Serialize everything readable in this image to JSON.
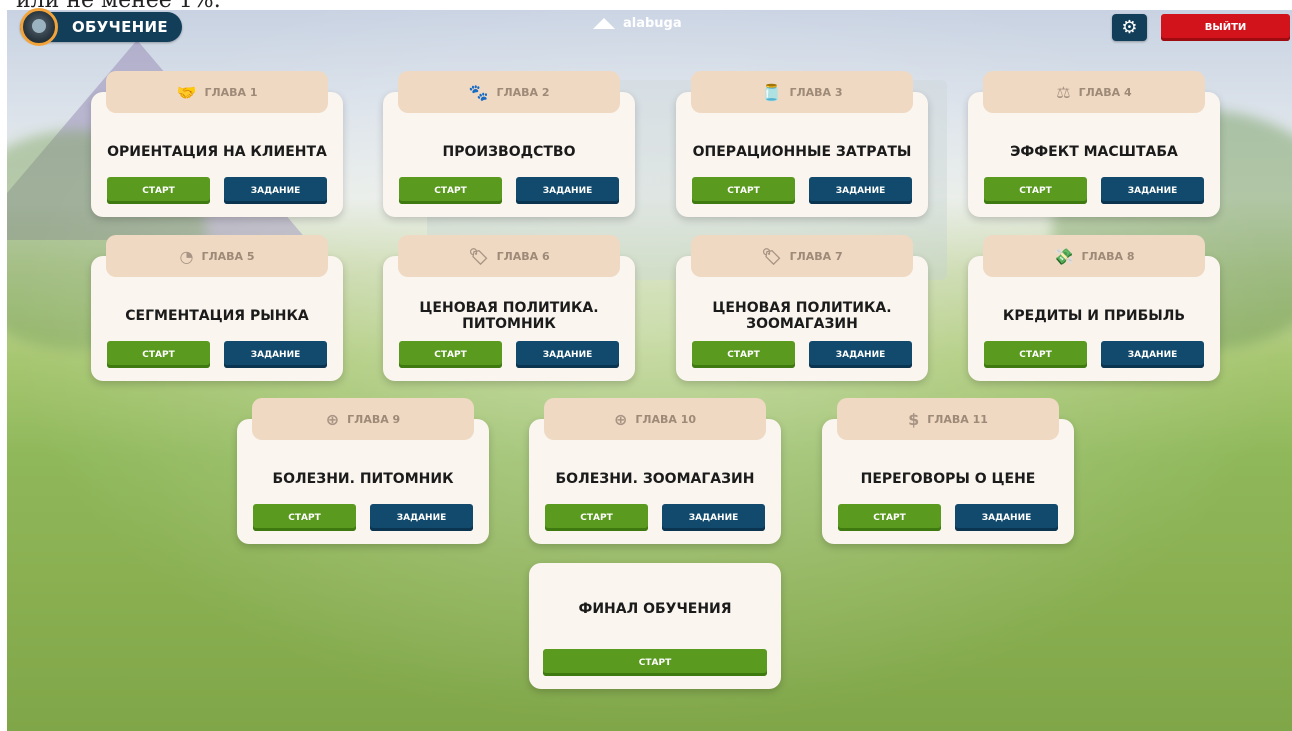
{
  "page_caption": "или не менее 1%.",
  "header": {
    "title": "ОБУЧЕНИЕ",
    "logo_text": "alabuga",
    "settings_icon": "gear-icon",
    "exit_label": "ВЫЙТИ"
  },
  "buttons": {
    "start": "СТАРТ",
    "task": "ЗАДАНИЕ"
  },
  "chapters": [
    {
      "label": "ГЛАВА 1",
      "icon": "handshake-icon",
      "glyph": "🤝",
      "title": "ОРИЕНТАЦИЯ НА КЛИЕНТА"
    },
    {
      "label": "ГЛАВА 2",
      "icon": "pet-icon",
      "glyph": "🐾",
      "title": "ПРОИЗВОДСТВО"
    },
    {
      "label": "ГЛАВА 3",
      "icon": "jar-icon",
      "glyph": "🫙",
      "title": "ОПЕРАЦИОННЫЕ ЗАТРАТЫ"
    },
    {
      "label": "ГЛАВА 4",
      "icon": "scale-icon",
      "glyph": "⚖",
      "title": "ЭФФЕКТ МАСШТАБА"
    },
    {
      "label": "ГЛАВА 5",
      "icon": "pie-chart-icon",
      "glyph": "◔",
      "title": "СЕГМЕНТАЦИЯ РЫНКА"
    },
    {
      "label": "ГЛАВА 6",
      "icon": "price-tag-icon",
      "glyph": "🏷",
      "title": "ЦЕНОВАЯ ПОЛИТИКА. ПИТОМНИК"
    },
    {
      "label": "ГЛАВА 7",
      "icon": "price-tag-icon",
      "glyph": "🏷",
      "title": "ЦЕНОВАЯ ПОЛИТИКА. ЗООМАГАЗИН"
    },
    {
      "label": "ГЛАВА 8",
      "icon": "money-icon",
      "glyph": "💸",
      "title": "КРЕДИТЫ И ПРИБЫЛЬ"
    },
    {
      "label": "ГЛАВА 9",
      "icon": "medkit-icon",
      "glyph": "⊕",
      "title": "БОЛЕЗНИ. ПИТОМНИК"
    },
    {
      "label": "ГЛАВА 10",
      "icon": "medkit-icon",
      "glyph": "⊕",
      "title": "БОЛЕЗНИ. ЗООМАГАЗИН"
    },
    {
      "label": "ГЛАВА 11",
      "icon": "coins-icon",
      "glyph": "$",
      "title": "ПЕРЕГОВОРЫ О ЦЕНЕ"
    }
  ],
  "final": {
    "title": "ФИНАЛ ОБУЧЕНИЯ"
  },
  "colors": {
    "start_green": "#5a9a1f",
    "task_blue": "#114a6c",
    "exit_red": "#d2131b",
    "card_bg": "#faf5ef",
    "tab_bg": "#f0d9c2",
    "header_navy": "#123e5a"
  }
}
